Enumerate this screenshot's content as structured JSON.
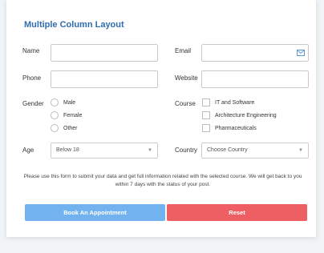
{
  "form": {
    "title": "Multiple Column Layout",
    "name": {
      "label": "Name",
      "value": ""
    },
    "email": {
      "label": "Email",
      "value": "",
      "icon": "mail-icon"
    },
    "phone": {
      "label": "Phone",
      "value": ""
    },
    "website": {
      "label": "Website",
      "value": ""
    },
    "gender": {
      "label": "Gender",
      "options": [
        "Male",
        "Female",
        "Other"
      ]
    },
    "course": {
      "label": "Course",
      "options": [
        "IT and Software",
        "Architecture Engineering",
        "Pharmaceuticals"
      ]
    },
    "age": {
      "label": "Age",
      "selected": "Below 18"
    },
    "country": {
      "label": "Country",
      "selected": "Choose Country"
    },
    "note": "Please use this form to submit your data and get full information related with the selected course. We will get back to you within 7 days with the status of your post.",
    "submit_label": "Book An Appointment",
    "reset_label": "Reset"
  },
  "colors": {
    "title": "#2f6db0",
    "submit": "#72b2ee",
    "reset": "#ee5f63"
  }
}
